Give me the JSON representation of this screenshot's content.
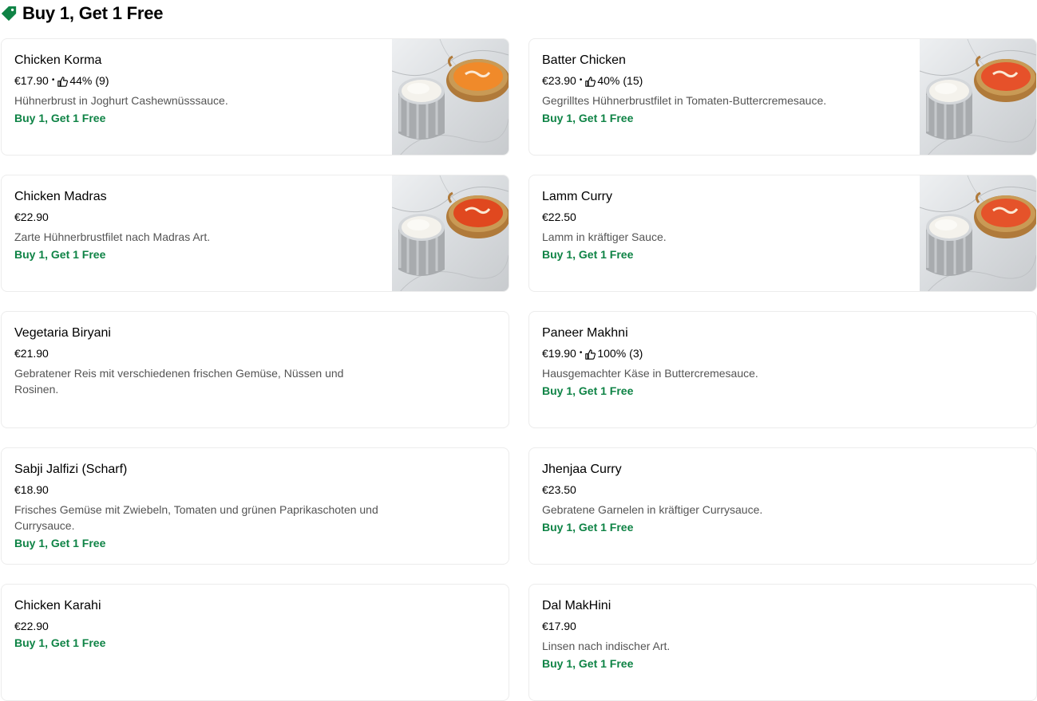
{
  "section": {
    "title": "Buy 1, Get 1 Free",
    "icon": "tag-icon",
    "accent": "#0e8345"
  },
  "items": [
    {
      "name": "Chicken Korma",
      "price": "€17.90",
      "rating_percent": "44%",
      "rating_count": "(9)",
      "description": "Hühnerbrust in Joghurt Cashewnüsssauce.",
      "promo": "Buy 1, Get 1 Free",
      "has_image": true,
      "curry_color": "#f08a2a"
    },
    {
      "name": "Batter Chicken",
      "price": "€23.90",
      "rating_percent": "40%",
      "rating_count": "(15)",
      "description": "Gegrilltes Hühnerbrustfilet in Tomaten-Buttercremesauce.",
      "promo": "Buy 1, Get 1 Free",
      "has_image": true,
      "curry_color": "#e6512a"
    },
    {
      "name": "Chicken Madras",
      "price": "€22.90",
      "description": "Zarte Hühnerbrustfilet nach Madras Art.",
      "promo": "Buy 1, Get 1 Free",
      "has_image": true,
      "curry_color": "#e0481f"
    },
    {
      "name": "Lamm Curry",
      "price": "€22.50",
      "description": "Lamm in kräftiger Sauce.",
      "promo": "Buy 1, Get 1 Free",
      "has_image": true,
      "curry_color": "#e5532a"
    },
    {
      "name": "Vegetaria Biryani",
      "price": "€21.90",
      "description": "Gebratener Reis mit verschiedenen frischen Gemüse, Nüssen und Rosinen.",
      "promo": "",
      "has_image": false
    },
    {
      "name": "Paneer Makhni",
      "price": "€19.90",
      "rating_percent": "100%",
      "rating_count": "(3)",
      "description": "Hausgemachter Käse in Buttercremesauce.",
      "promo": "Buy 1, Get 1 Free",
      "has_image": false
    },
    {
      "name": "Sabji Jalfizi (Scharf)",
      "price": "€18.90",
      "description": "Frisches Gemüse mit Zwiebeln, Tomaten und grünen Paprikaschoten und Currysauce.",
      "promo": "Buy 1, Get 1 Free",
      "has_image": false
    },
    {
      "name": "Jhenjaa Curry",
      "price": "€23.50",
      "description": "Gebratene Garnelen in kräftiger Currysauce.",
      "promo": "Buy 1, Get 1 Free",
      "has_image": false
    },
    {
      "name": "Chicken Karahi",
      "price": "€22.90",
      "description": "",
      "promo": "Buy 1, Get 1 Free",
      "has_image": false
    },
    {
      "name": "Dal MakHini",
      "price": "€17.90",
      "description": "Linsen nach indischer Art.",
      "promo": "Buy 1, Get 1 Free",
      "has_image": false
    }
  ]
}
